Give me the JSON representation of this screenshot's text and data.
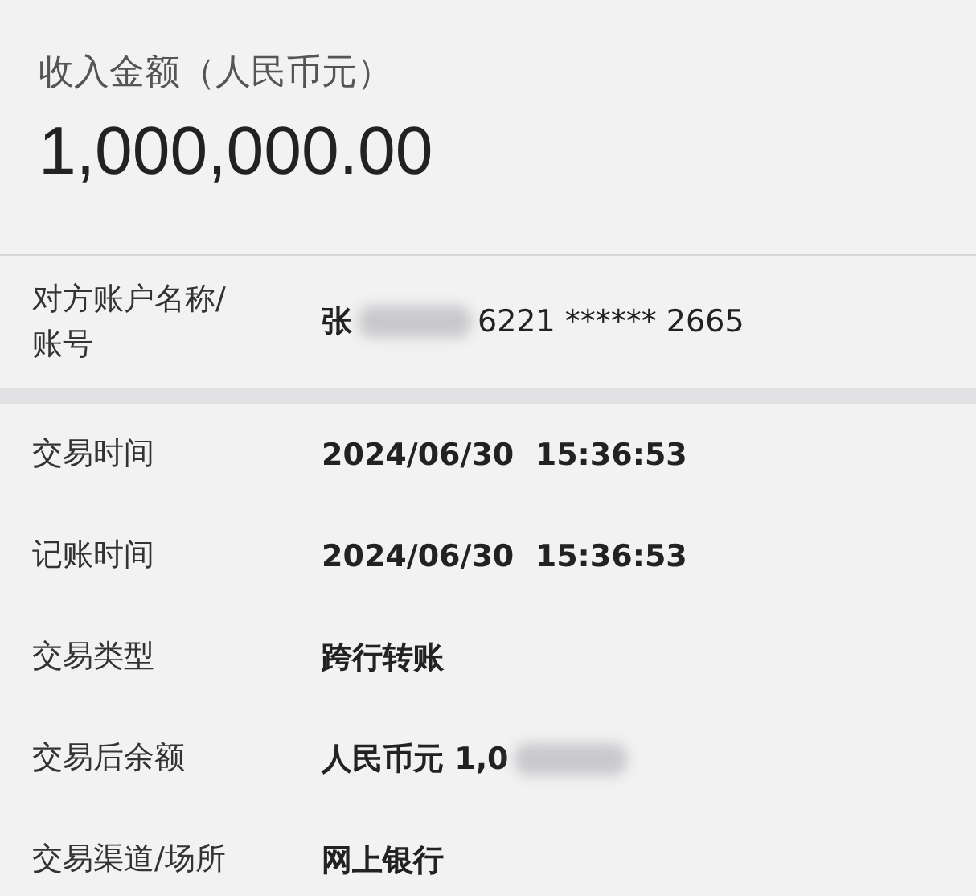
{
  "header": {
    "title": "收入金额（人民币元）",
    "amount": "1,000,000.00"
  },
  "counterparty": {
    "label": "对方账户名称/账号",
    "value": "张",
    "redacted": true,
    "value_after": "6221 ****** 2665"
  },
  "details": [
    {
      "label": "交易时间",
      "value": "2024/06/30  15:36:53",
      "redacted": false
    },
    {
      "label": "记账时间",
      "value": "2024/06/30  15:36:53",
      "redacted": false
    },
    {
      "label": "交易类型",
      "value": "跨行转账",
      "redacted": false
    },
    {
      "label": "交易后余额",
      "value": "人民币元 1,0",
      "redacted": true
    },
    {
      "label": "交易渠道/场所",
      "value": "网上银行",
      "redacted": false
    }
  ]
}
